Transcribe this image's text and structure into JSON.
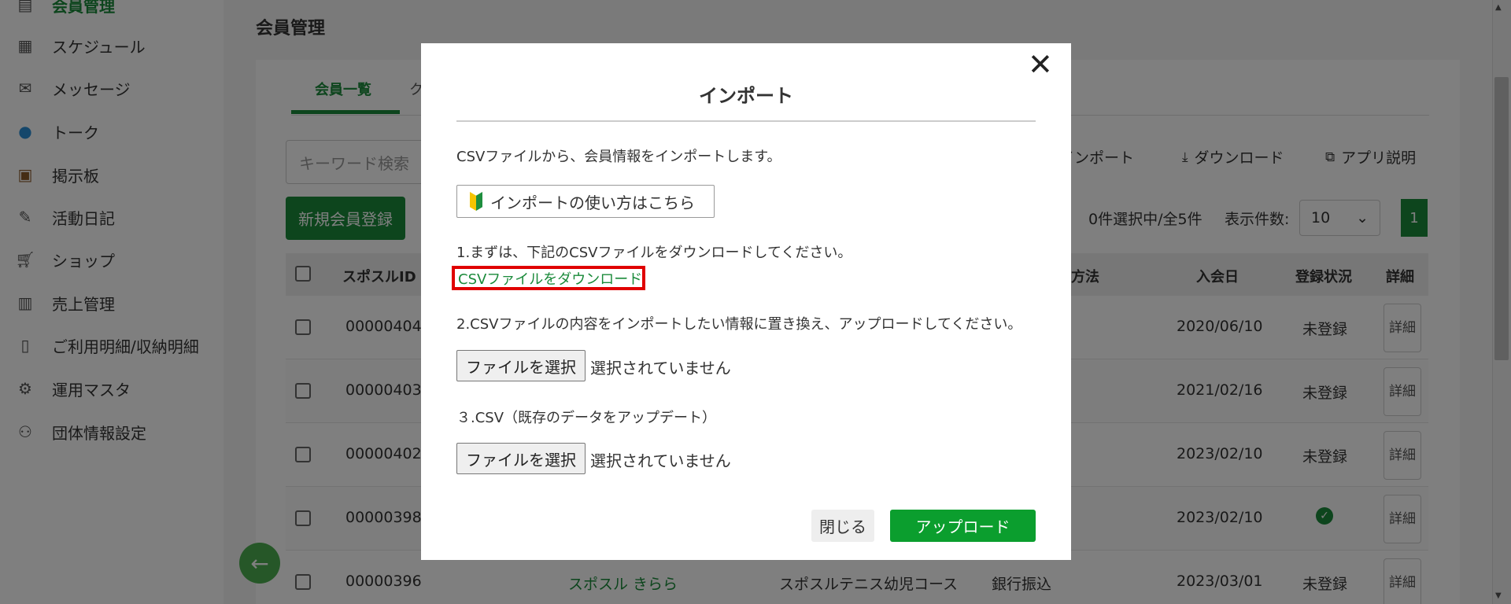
{
  "sidebar": {
    "items": [
      {
        "label": "会員管理",
        "icon": "member-icon"
      },
      {
        "label": "スケジュール",
        "icon": "calendar-icon"
      },
      {
        "label": "メッセージ",
        "icon": "mail-icon"
      },
      {
        "label": "トーク",
        "icon": "chat-icon"
      },
      {
        "label": "掲示板",
        "icon": "board-icon"
      },
      {
        "label": "活動日記",
        "icon": "diary-icon"
      },
      {
        "label": "ショップ",
        "icon": "cart-icon"
      },
      {
        "label": "売上管理",
        "icon": "sales-icon"
      },
      {
        "label": "ご利用明細/収納明細",
        "icon": "receipt-icon"
      },
      {
        "label": "運用マスタ",
        "icon": "master-icon"
      },
      {
        "label": "団体情報設定",
        "icon": "group-icon"
      }
    ]
  },
  "header": {
    "title": "会員管理"
  },
  "tabs": [
    {
      "label": "会員一覧"
    },
    {
      "label": "ク"
    }
  ],
  "search": {
    "placeholder": "キーワード検索"
  },
  "toolbar": {
    "import_label": "インポート",
    "download_label": "ダウンロード",
    "app_help_label": "アプリ説明"
  },
  "list": {
    "new_button": "新規会員登録",
    "count_text": "0件選択中/全5件",
    "per_page_label": "表示件数:",
    "per_page_value": "10",
    "current_page": "1"
  },
  "table": {
    "headers": {
      "id": "スポスルID",
      "method": "方法",
      "joined": "入会日",
      "status": "登録状況",
      "detail": "詳細"
    },
    "rows": [
      {
        "id": "00000404",
        "name": "",
        "course": "",
        "method": "",
        "joined": "2020/06/10",
        "status": "未登録",
        "registered": false
      },
      {
        "id": "00000403",
        "name": "",
        "course": "",
        "method": "",
        "joined": "2021/02/16",
        "status": "未登録",
        "registered": false
      },
      {
        "id": "00000402",
        "name": "",
        "course": "",
        "method": "",
        "joined": "2023/02/10",
        "status": "未登録",
        "registered": false
      },
      {
        "id": "00000398",
        "name": "",
        "course": "",
        "method": "",
        "joined": "2023/02/10",
        "status": "",
        "registered": true
      },
      {
        "id": "00000396",
        "name": "スポスル きらら",
        "course": "スポスルテニス幼児コース",
        "method": "銀行振込",
        "joined": "2023/03/01",
        "status": "未登録",
        "registered": false
      }
    ],
    "detail_label": "詳細"
  },
  "modal": {
    "title": "インポート",
    "intro": "CSVファイルから、会員情報をインポートします。",
    "howto_button": "インポートの使い方はこちら",
    "step1": "1.まずは、下記のCSVファイルをダウンロードしてください。",
    "csv_download_link": "CSVファイルをダウンロード",
    "step2": "2.CSVファイルの内容をインポートしたい情報に置き換え、アップロードしてください。",
    "file_button_1": "ファイルを選択",
    "file_status_1": "選択されていません",
    "step3": "３.CSV（既存のデータをアップデート）",
    "file_button_2": "ファイルを選択",
    "file_status_2": "選択されていません",
    "close_button": "閉じる",
    "upload_button": "アップロード"
  },
  "colors": {
    "brand_green": "#1a8a3a",
    "upload_green": "#0b9e2e",
    "highlight_red": "#e00000"
  }
}
